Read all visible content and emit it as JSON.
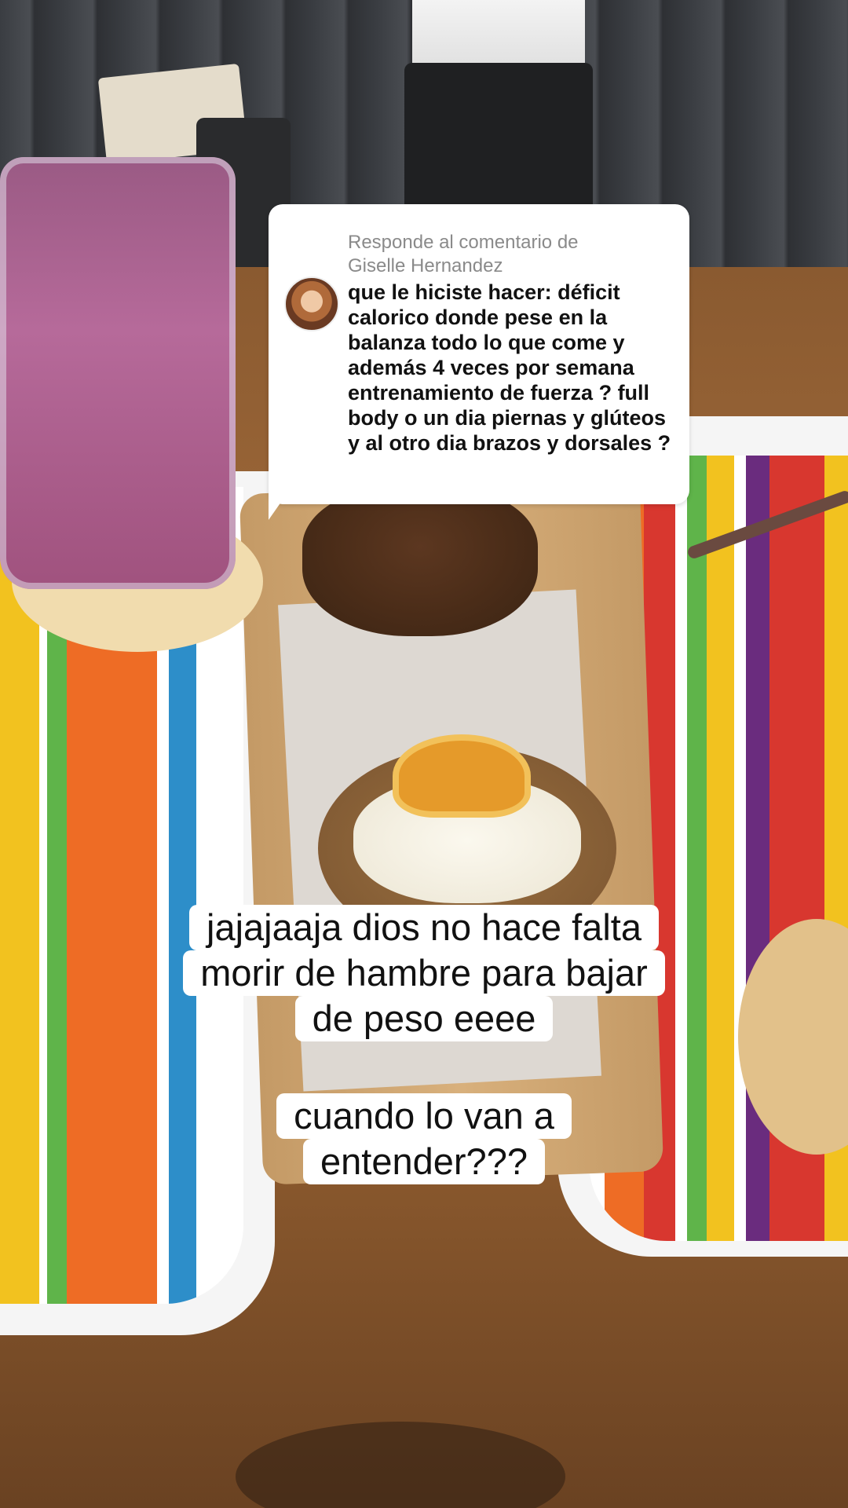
{
  "reply": {
    "header_line1": "Responde al comentario de",
    "header_line2": "Giselle Hernandez",
    "comment": "que le hiciste hacer: déficit calorico donde pese en la balanza todo lo que come y además 4 veces por semana entrenamiento de fuerza ? full body o un dia piernas y glúteos y al otro dia brazos y dorsales ?"
  },
  "captions": {
    "first": {
      "line1": "jajajaaja dios no hace falta",
      "line2": "morir de hambre para bajar",
      "line3": "de peso eeee"
    },
    "second": {
      "line1": "cuando lo van a",
      "line2": "entender???"
    }
  }
}
